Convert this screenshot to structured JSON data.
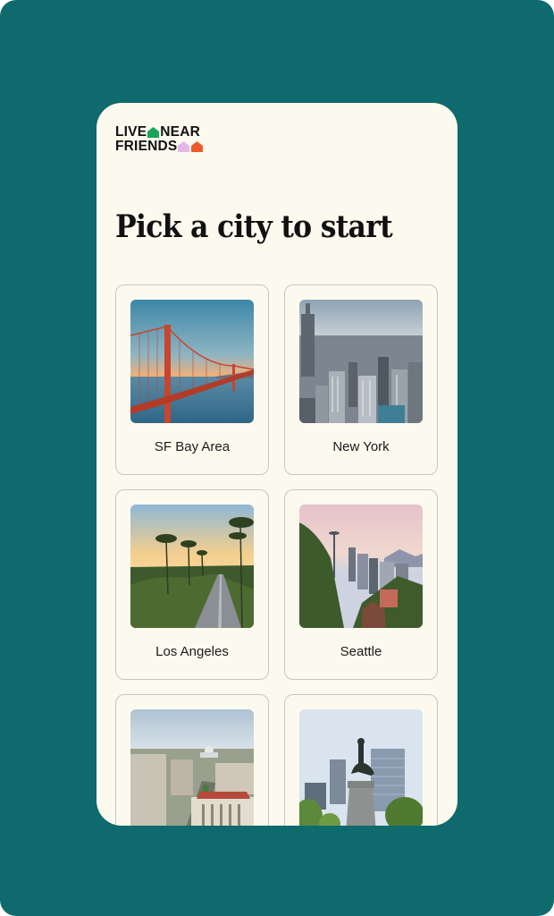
{
  "logo": {
    "line1_left": "LIVE",
    "line1_right": "NEAR",
    "line2": "FRIENDS",
    "house_colors": [
      "#1aa55a",
      "#e3b7e8",
      "#ee5a2c"
    ]
  },
  "title": "Pick a city to start",
  "cities": [
    {
      "label": "SF Bay Area",
      "icon": "golden-gate-bridge-photo"
    },
    {
      "label": "New York",
      "icon": "manhattan-skyline-photo"
    },
    {
      "label": "Los Angeles",
      "icon": "palm-tree-road-photo"
    },
    {
      "label": "Seattle",
      "icon": "space-needle-photo"
    },
    {
      "label": "",
      "icon": "washington-dc-capitol-photo"
    },
    {
      "label": "",
      "icon": "boston-statue-photo"
    }
  ],
  "colors": {
    "background": "#0f6a6d",
    "surface": "#fcfaef",
    "card_border": "#c9c6bd",
    "text": "#111111"
  }
}
